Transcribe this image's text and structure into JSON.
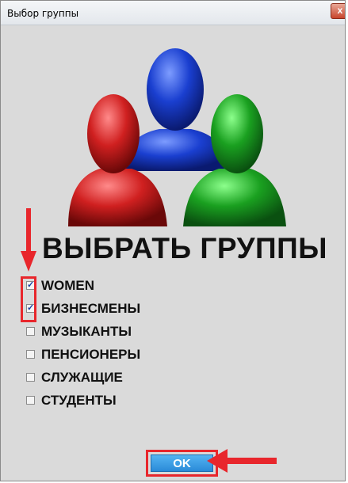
{
  "window": {
    "title": "Выбор группы",
    "close_symbol": "x"
  },
  "heading": "ВЫБРАТЬ ГРУППЫ",
  "groups": [
    {
      "label": "WOMEN",
      "checked": true
    },
    {
      "label": "БИЗНЕСМЕНЫ",
      "checked": true
    },
    {
      "label": "МУЗЫКАНТЫ",
      "checked": false
    },
    {
      "label": "ПЕНСИОНЕРЫ",
      "checked": false
    },
    {
      "label": "СЛУЖАЩИЕ",
      "checked": false
    },
    {
      "label": "СТУДЕНТЫ",
      "checked": false
    }
  ],
  "ok_label": "OK",
  "colors": {
    "annotation": "#e8262c",
    "ok_button": "#3a9be5",
    "figure_red": "#d02020",
    "figure_blue": "#1a3fd0",
    "figure_green": "#1aa020"
  },
  "icons": {
    "logo": "group-users-icon",
    "annotation_down": "arrow-down-icon",
    "annotation_left": "arrow-left-icon"
  }
}
